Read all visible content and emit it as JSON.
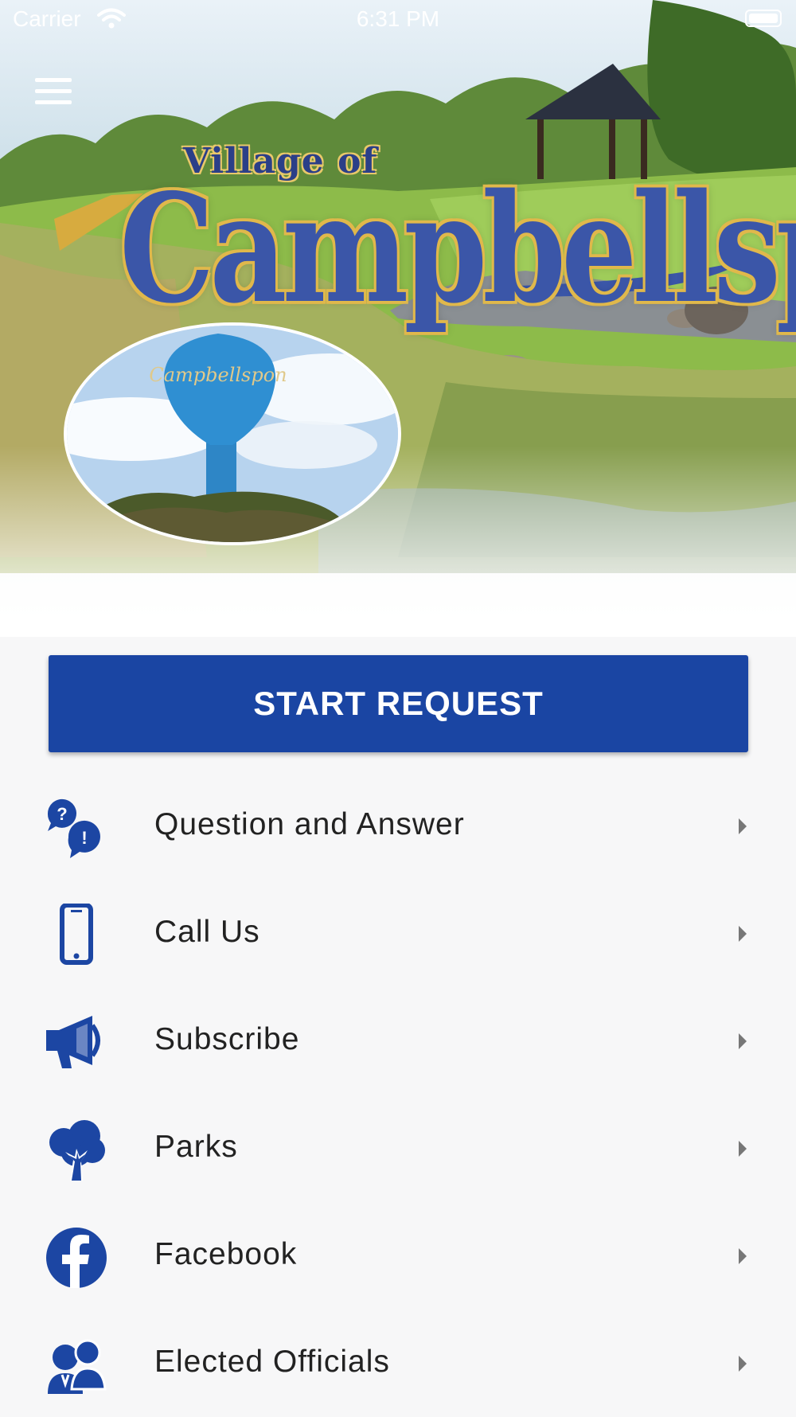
{
  "status_bar": {
    "carrier": "Carrier",
    "time": "6:31 PM"
  },
  "logo": {
    "line1": "Village of",
    "line2": "Campbellsport"
  },
  "tower_photo": {
    "caption": "Campbellspon"
  },
  "start_request": {
    "label": "START REQUEST"
  },
  "menu": {
    "items": [
      {
        "label": "Question and Answer",
        "icon": "question-answer-icon"
      },
      {
        "label": "Call Us",
        "icon": "phone-icon"
      },
      {
        "label": "Subscribe",
        "icon": "megaphone-icon"
      },
      {
        "label": "Parks",
        "icon": "tree-icon"
      },
      {
        "label": "Facebook",
        "icon": "facebook-icon"
      },
      {
        "label": "Elected Officials",
        "icon": "officials-icon"
      }
    ]
  },
  "colors": {
    "accent": "#1a45a3",
    "icon": "#1c46a3",
    "background": "#f7f7f8"
  }
}
